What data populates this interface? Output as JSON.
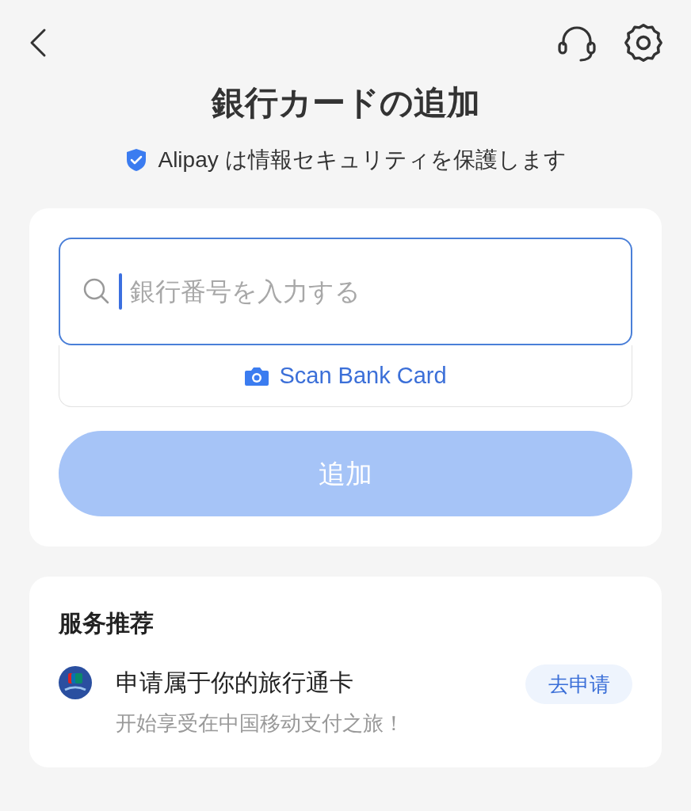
{
  "title": "銀行カードの追加",
  "security_note": "Alipay は情報セキュリティを保護します",
  "card_number_field": {
    "placeholder": "銀行番号を入力する",
    "focused": true
  },
  "scan_button": {
    "label": "Scan Bank Card"
  },
  "add_button": {
    "label": "追加",
    "disabled": true
  },
  "recommendations": {
    "heading": "服务推荐",
    "items": [
      {
        "title": "申请属于你的旅行通卡",
        "subtitle": "开始享受在中国移动支付之旅！",
        "action": "去申请"
      }
    ]
  }
}
